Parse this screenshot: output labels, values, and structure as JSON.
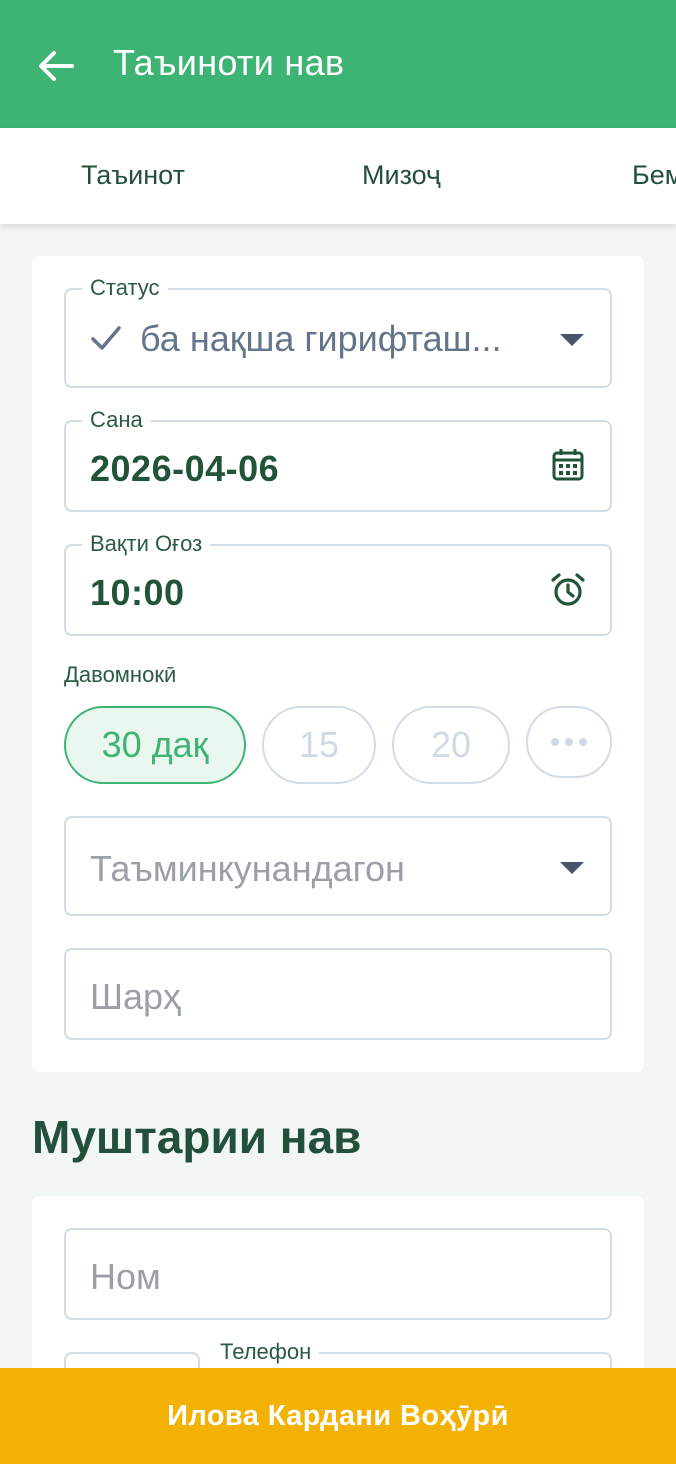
{
  "header": {
    "back_icon": "arrow-left-icon",
    "title": "Таъиноти нав"
  },
  "tabs": [
    {
      "label": "Таъинот"
    },
    {
      "label": "Мизоҷ"
    },
    {
      "label": "Бем"
    }
  ],
  "appointment": {
    "status": {
      "label": "Статус",
      "value": "ба нақша гирифташ...",
      "icon": "check-icon"
    },
    "date": {
      "label": "Сана",
      "value": "2026-04-06",
      "icon": "calendar-icon"
    },
    "start_time": {
      "label": "Вақти Оғоз",
      "value": "10:00",
      "icon": "alarm-clock-icon"
    },
    "duration": {
      "label": "Давомнокӣ",
      "options": [
        "30 дақ",
        "15",
        "20"
      ],
      "selected": "30 дақ",
      "more_icon": "more-horizontal-icon"
    },
    "providers": {
      "placeholder": "Таъминкунандагон"
    },
    "description": {
      "placeholder": "Шарҳ"
    }
  },
  "new_client": {
    "title": "Муштарии нав",
    "name_placeholder": "Ном",
    "phone_label": "Телефон"
  },
  "footer": {
    "add_button": "Илова Кардани Воҳӯрӣ"
  },
  "colors": {
    "primary": "#3db374",
    "accent": "#f2b103",
    "text_dark": "#23503a",
    "border": "#d3dbe6"
  }
}
